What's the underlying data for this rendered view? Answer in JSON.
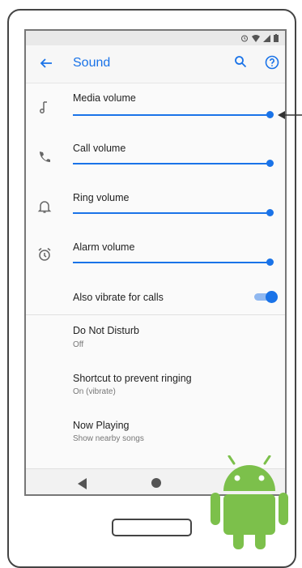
{
  "app": {
    "title": "Sound"
  },
  "toolbar": {
    "back_icon": "arrow-back-icon",
    "search_icon": "search-icon",
    "help_icon": "help-circle-icon"
  },
  "status_bar": {
    "icons": [
      "alarm-icon",
      "wifi-icon",
      "signal-icon",
      "battery-icon"
    ]
  },
  "volume_sliders": [
    {
      "label": "Media volume",
      "icon": "music-note-icon",
      "level": 1.0
    },
    {
      "label": "Call volume",
      "icon": "phone-icon",
      "level": 1.0
    },
    {
      "label": "Ring volume",
      "icon": "bell-icon",
      "level": 1.0
    },
    {
      "label": "Alarm volume",
      "icon": "alarm-clock-icon",
      "level": 1.0
    }
  ],
  "vibrate": {
    "label": "Also vibrate for calls",
    "enabled": true
  },
  "settings_items": [
    {
      "title": "Do Not Disturb",
      "subtitle": "Off"
    },
    {
      "title": "Shortcut to prevent ringing",
      "subtitle": "On (vibrate)"
    },
    {
      "title": "Now Playing",
      "subtitle": "Show nearby songs"
    }
  ],
  "colors": {
    "accent": "#1a73e8",
    "android_green": "#7cc04b"
  },
  "nav": {
    "back_icon": "nav-back-icon",
    "home_icon": "nav-home-icon"
  }
}
